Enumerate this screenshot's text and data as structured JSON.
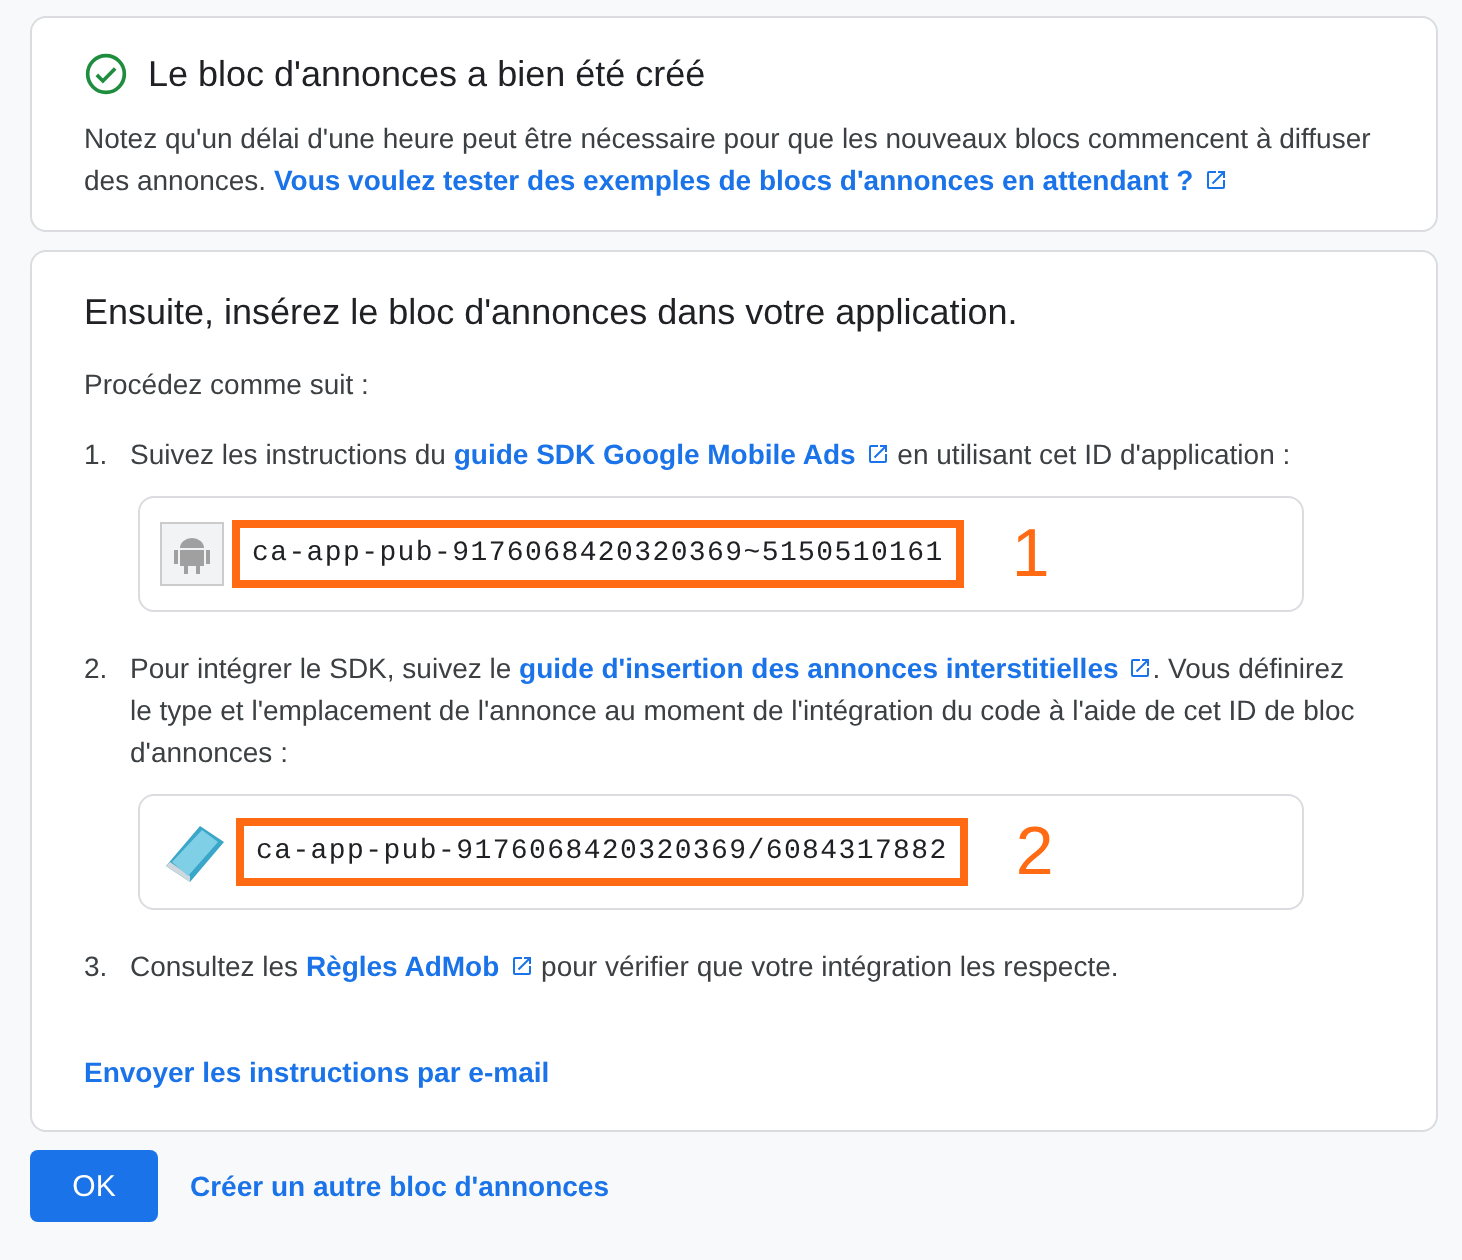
{
  "success": {
    "title": "Le bloc d'annonces a bien été créé",
    "parts": [
      {
        "kind": "text",
        "text": "Notez qu'un délai d'une heure peut être nécessaire pour que les nouveaux blocs commencent à diffuser des annonces. "
      },
      {
        "kind": "link",
        "text": "Vous voulez tester des exemples de blocs d'annonces en attendant ?"
      }
    ]
  },
  "instructions": {
    "title": "Ensuite, insérez le bloc d'annonces dans votre application.",
    "intro": "Procédez comme suit :",
    "steps": [
      {
        "number": "1.",
        "parts": [
          {
            "kind": "text",
            "text": "Suivez les instructions du "
          },
          {
            "kind": "link",
            "text": "guide SDK Google Mobile Ads"
          },
          {
            "kind": "text",
            "text": " en utilisant cet ID d'application :"
          }
        ],
        "id_box": {
          "kind": "android",
          "value": "ca-app-pub-9176068420320369~5150510161",
          "callout": "1"
        }
      },
      {
        "number": "2.",
        "parts": [
          {
            "kind": "text",
            "text": "Pour intégrer le SDK, suivez le "
          },
          {
            "kind": "link",
            "text": "guide d'insertion des annonces interstitielles"
          },
          {
            "kind": "text",
            "text": ". Vous définirez le type et l'emplacement de l'annonce au moment de l'intégration du code à l'aide de cet ID de bloc d'annonces :"
          }
        ],
        "id_box": {
          "kind": "book",
          "value": "ca-app-pub-9176068420320369/6084317882",
          "callout": "2"
        }
      },
      {
        "number": "3.",
        "parts": [
          {
            "kind": "text",
            "text": "Consultez les "
          },
          {
            "kind": "link",
            "text": "Règles AdMob"
          },
          {
            "kind": "text",
            "text": " pour vérifier que votre intégration les respecte."
          }
        ]
      }
    ],
    "email_link": "Envoyer les instructions par e-mail"
  },
  "actions": {
    "primary": "OK",
    "secondary": "Créer un autre bloc d'annonces"
  }
}
